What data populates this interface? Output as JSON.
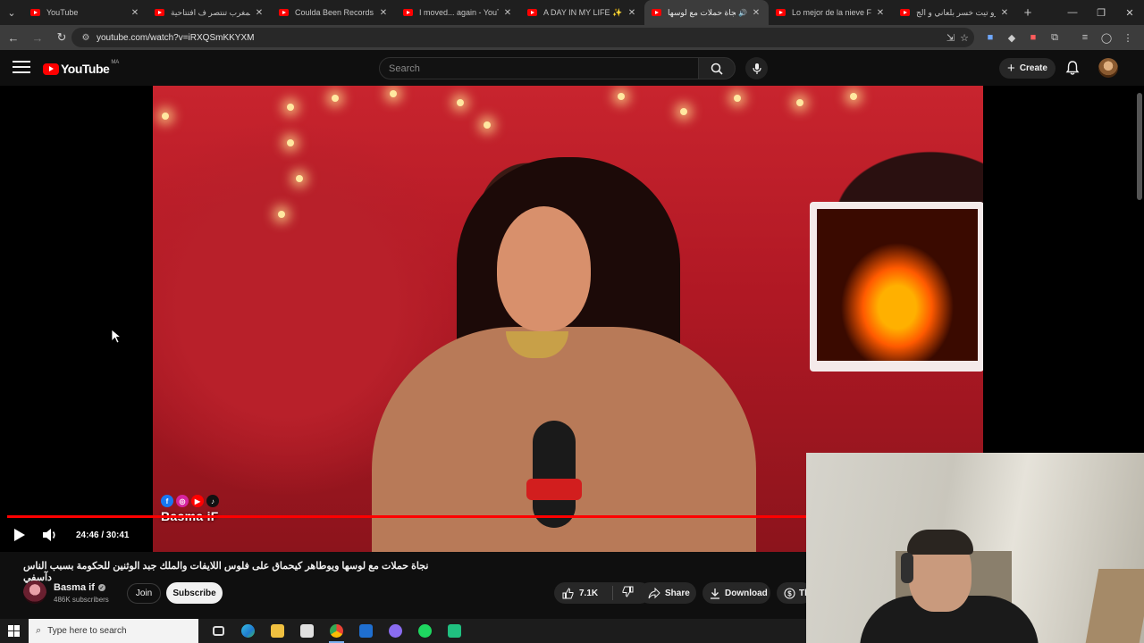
{
  "browser": {
    "tabs": [
      {
        "title": "YouTube",
        "active": false
      },
      {
        "title": "المغرب تنتصر ف افتتاحية",
        "active": false
      },
      {
        "title": "Coulda Been Records BRO",
        "active": false
      },
      {
        "title": "I moved... again - YouTub",
        "active": false
      },
      {
        "title": "A DAY IN MY LIFE ✨ يعري",
        "active": false
      },
      {
        "title": "نجاة حملات مع لوسها",
        "active": true
      },
      {
        "title": "Lo mejor de la nieve Filon",
        "active": false
      },
      {
        "title": "أندرو تيت خسر بلعاني و الج",
        "active": false
      }
    ],
    "url": "youtube.com/watch?v=iRXQSmKKYXM"
  },
  "youtube": {
    "logo_text": "YouTube",
    "country_code": "MA",
    "search_placeholder": "Search",
    "create_label": "Create"
  },
  "player": {
    "time_display": "24:46 / 30:41",
    "progress_fraction": 0.806,
    "watermark": "Basma iF"
  },
  "video": {
    "title": "نجاة حملات مع لوسها ويوطاهر كيحماق على فلوس اللايفات والملك جبد الوثنين للحكومة بسبب الناس دآسفي",
    "channel_name": "Basma if",
    "subscribers": "486K subscribers",
    "join_label": "Join",
    "subscribe_label": "Subscribe",
    "likes": "7.1K",
    "share_label": "Share",
    "download_label": "Download",
    "thanks_label": "Th"
  },
  "taskbar": {
    "search_placeholder": "Type here to search"
  },
  "colors": {
    "yt_red": "#ff0000",
    "background": "#0f0f0f"
  }
}
